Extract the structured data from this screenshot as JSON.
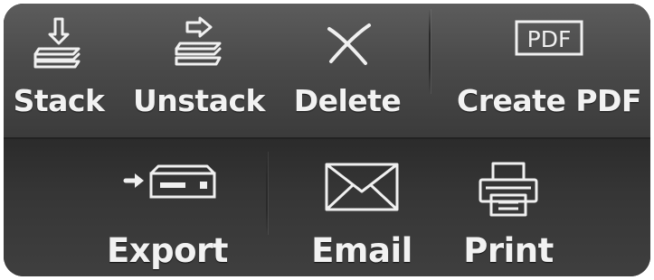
{
  "toolbar": {
    "top_row": [
      {
        "id": "stack",
        "label": "Stack",
        "icon": "stack-icon"
      },
      {
        "id": "unstack",
        "label": "Unstack",
        "icon": "unstack-icon"
      },
      {
        "id": "delete",
        "label": "Delete",
        "icon": "delete-x-icon"
      },
      {
        "id": "create_pdf",
        "label": "Create PDF",
        "icon": "pdf-icon",
        "icon_text": "PDF"
      }
    ],
    "bottom_row": [
      {
        "id": "export",
        "label": "Export",
        "icon": "export-drive-icon"
      },
      {
        "id": "email",
        "label": "Email",
        "icon": "envelope-icon"
      },
      {
        "id": "print",
        "label": "Print",
        "icon": "printer-icon"
      }
    ]
  },
  "colors": {
    "background": "#3a3a3a",
    "label": "#f2f2f2",
    "icon_stroke": "#f0f0f0"
  }
}
